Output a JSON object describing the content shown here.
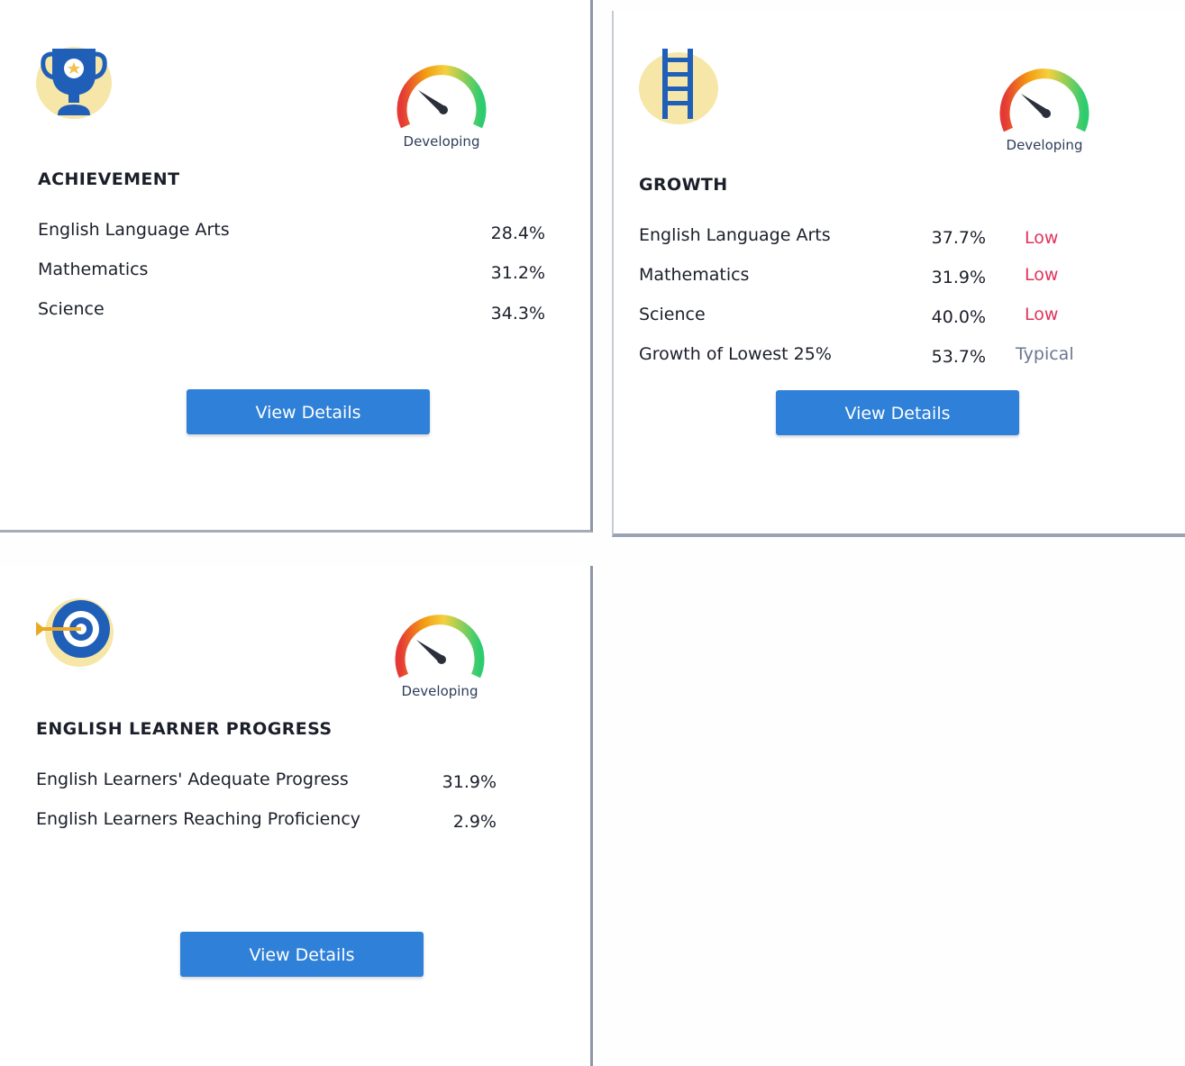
{
  "cards": [
    {
      "title": "ACHIEVEMENT",
      "icon": "trophy-icon",
      "gauge": {
        "label": "Developing",
        "level": 0.3
      },
      "rows": [
        {
          "label": "English Language Arts",
          "value": "28.4%"
        },
        {
          "label": "Mathematics",
          "value": "31.2%"
        },
        {
          "label": "Science",
          "value": "34.3%"
        }
      ],
      "button": "View Details"
    },
    {
      "title": "GROWTH",
      "icon": "ladder-icon",
      "gauge": {
        "label": "Developing",
        "level": 0.3
      },
      "rows": [
        {
          "label": "English Language Arts",
          "value": "37.7%",
          "level": "Low"
        },
        {
          "label": "Mathematics",
          "value": "31.9%",
          "level": "Low"
        },
        {
          "label": "Science",
          "value": "40.0%",
          "level": "Low"
        },
        {
          "label": "Growth of Lowest 25%",
          "value": "53.7%",
          "level": "Typical"
        }
      ],
      "button": "View Details"
    },
    {
      "title": "ENGLISH LEARNER PROGRESS",
      "icon": "target-icon",
      "gauge": {
        "label": "Developing",
        "level": 0.3
      },
      "rows": [
        {
          "label": "English Learners' Adequate Progress",
          "value": "31.9%"
        },
        {
          "label": "English Learners Reaching Proficiency",
          "value": "2.9%"
        }
      ],
      "button": "View Details"
    }
  ],
  "colors": {
    "button": "#2f80d8",
    "low": "#e0345b",
    "typical": "#6b7691",
    "icon_blue": "#1f5fb8",
    "icon_bg": "#f6e6a8"
  }
}
